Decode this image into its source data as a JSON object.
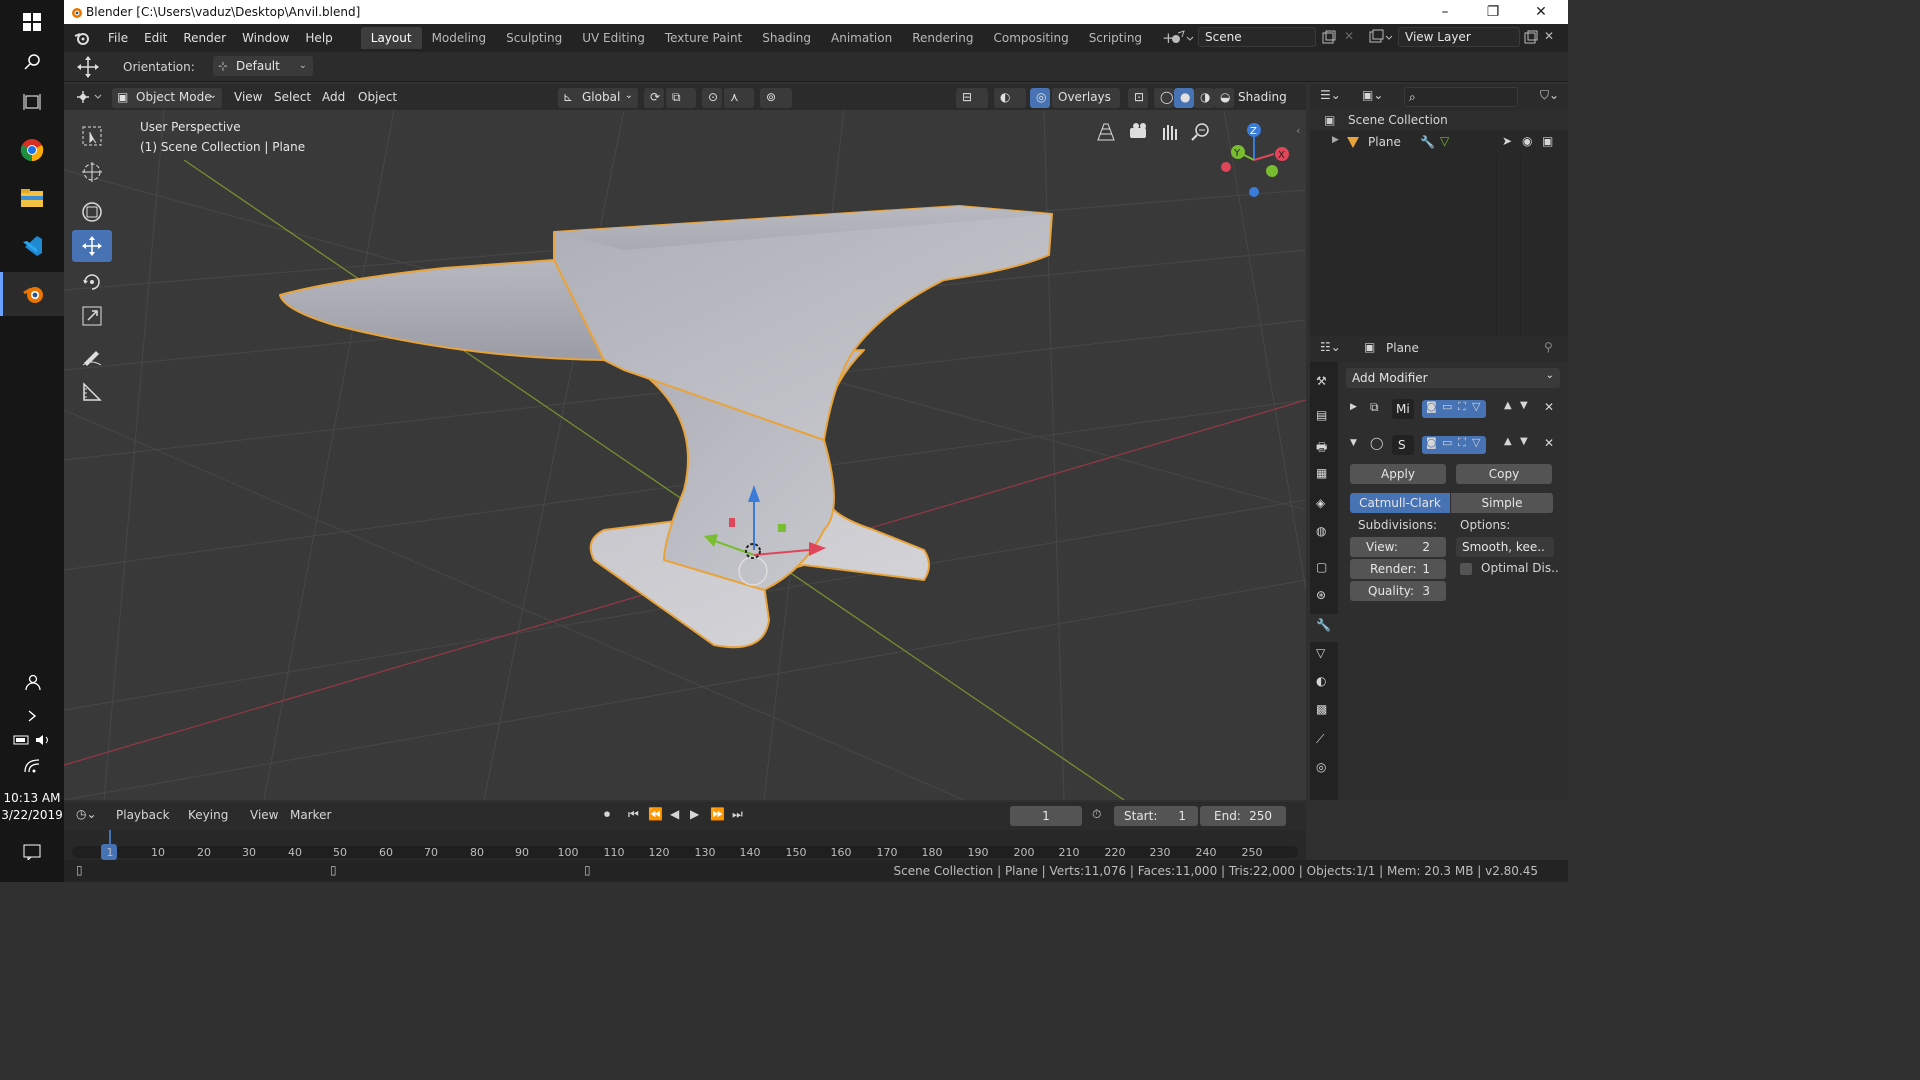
{
  "window": {
    "title": "Blender [C:\\Users\\vaduz\\Desktop\\Anvil.blend]",
    "minimize": "–",
    "maximize": "❐",
    "close": "✕"
  },
  "os": {
    "time": "10:13 AM",
    "date": "3/22/2019"
  },
  "menu": [
    "File",
    "Edit",
    "Render",
    "Window",
    "Help"
  ],
  "workspaces": [
    "Layout",
    "Modeling",
    "Sculpting",
    "UV Editing",
    "Texture Paint",
    "Shading",
    "Animation",
    "Rendering",
    "Compositing",
    "Scripting"
  ],
  "active_workspace": "Layout",
  "scene": {
    "name": "Scene",
    "view_layer": "View Layer"
  },
  "tool_settings": {
    "orientation_label": "Orientation:",
    "orientation_value": "Default"
  },
  "viewport_header": {
    "mode": "Object Mode",
    "view": "View",
    "select": "Select",
    "add": "Add",
    "object": "Object",
    "transform": "Global",
    "overlays": "Overlays",
    "shading": "Shading"
  },
  "viewport_info": {
    "perspective": "User Perspective",
    "collection": "(1) Scene Collection | Plane"
  },
  "gizmo": {
    "x": "X",
    "y": "Y",
    "z": "Z"
  },
  "outliner": {
    "root": "Scene Collection",
    "item": "Plane"
  },
  "properties": {
    "object_name": "Plane",
    "add_modifier": "Add Modifier",
    "modifier1": {
      "name": "Mi"
    },
    "modifier2": {
      "name": "S"
    },
    "apply": "Apply",
    "copy": "Copy",
    "catmull": "Catmull-Clark",
    "simple": "Simple",
    "subdivisions_label": "Subdivisions:",
    "options_label": "Options:",
    "view": {
      "label": "View:",
      "value": "2"
    },
    "render": {
      "label": "Render:",
      "value": "1"
    },
    "quality": {
      "label": "Quality:",
      "value": "3"
    },
    "smooth": "Smooth, kee..",
    "optimal": "Optimal Dis.."
  },
  "timeline": {
    "playback": "Playback",
    "keying": "Keying",
    "view": "View",
    "marker": "Marker",
    "current_frame": "1",
    "start_label": "Start:",
    "start": "1",
    "end_label": "End:",
    "end": "250",
    "ticks": [
      "1",
      "10",
      "20",
      "30",
      "40",
      "50",
      "60",
      "70",
      "80",
      "90",
      "100",
      "110",
      "120",
      "130",
      "140",
      "150",
      "160",
      "170",
      "180",
      "190",
      "200",
      "210",
      "220",
      "230",
      "240",
      "250"
    ]
  },
  "status": "Scene Collection | Plane | Verts:11,076 | Faces:11,000 | Tris:22,000 | Objects:1/1 | Mem: 20.3 MB | v2.80.45",
  "colors": {
    "accent": "#4772b3",
    "selection": "#e8a33a",
    "grid": "#474747",
    "x_axis": "#9a3b4a",
    "y_axis": "#7f9a32"
  }
}
